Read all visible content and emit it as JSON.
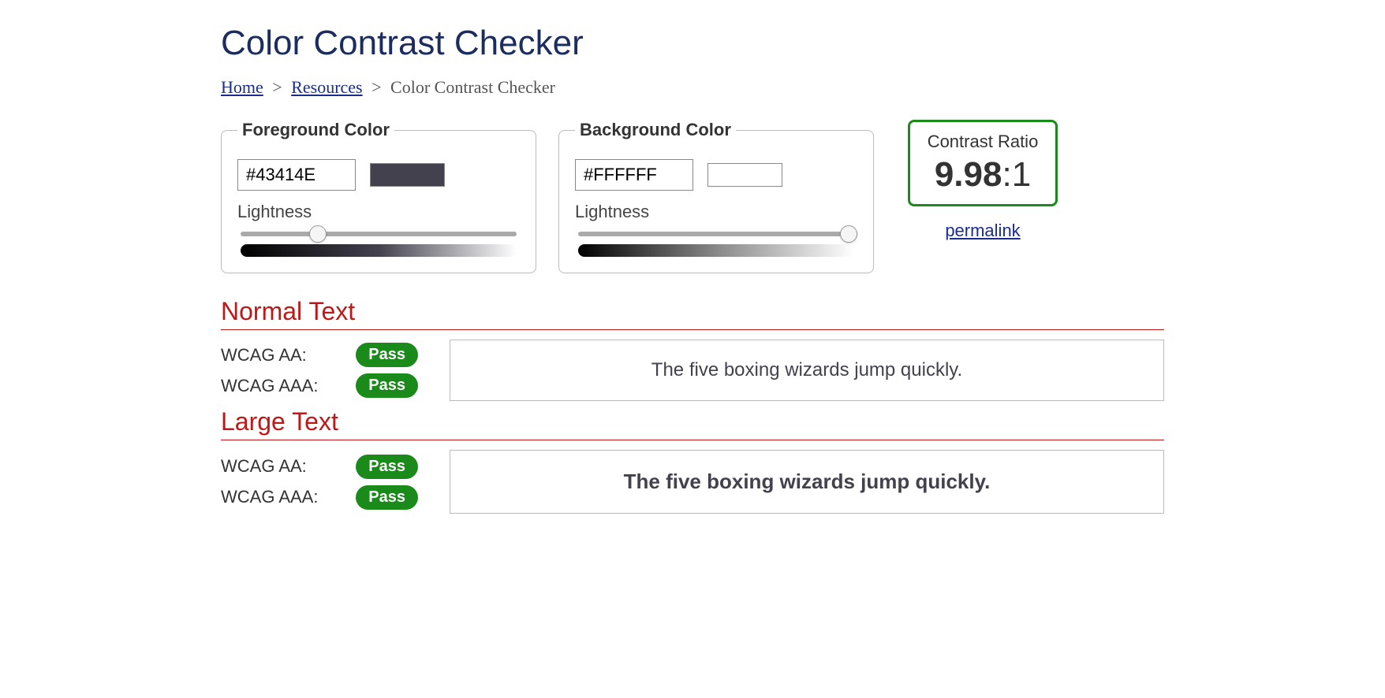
{
  "title": "Color Contrast Checker",
  "breadcrumb": {
    "home": "Home",
    "resources": "Resources",
    "current": "Color Contrast Checker",
    "sep": ">"
  },
  "foreground": {
    "legend": "Foreground Color",
    "value": "#43414E",
    "lightness_label": "Lightness",
    "slider_percent": 28
  },
  "background": {
    "legend": "Background Color",
    "value": "#FFFFFF",
    "lightness_label": "Lightness",
    "slider_percent": 98
  },
  "ratio": {
    "label": "Contrast Ratio",
    "value": "9.98",
    "suffix": ":1"
  },
  "permalink": "permalink",
  "normal": {
    "title": "Normal Text",
    "aa_label": "WCAG AA:",
    "aa_result": "Pass",
    "aaa_label": "WCAG AAA:",
    "aaa_result": "Pass",
    "sample": "The five boxing wizards jump quickly."
  },
  "large": {
    "title": "Large Text",
    "aa_label": "WCAG AA:",
    "aa_result": "Pass",
    "aaa_label": "WCAG AAA:",
    "aaa_result": "Pass",
    "sample": "The five boxing wizards jump quickly."
  },
  "colors": {
    "fg": "#43414E",
    "bg": "#FFFFFF"
  }
}
